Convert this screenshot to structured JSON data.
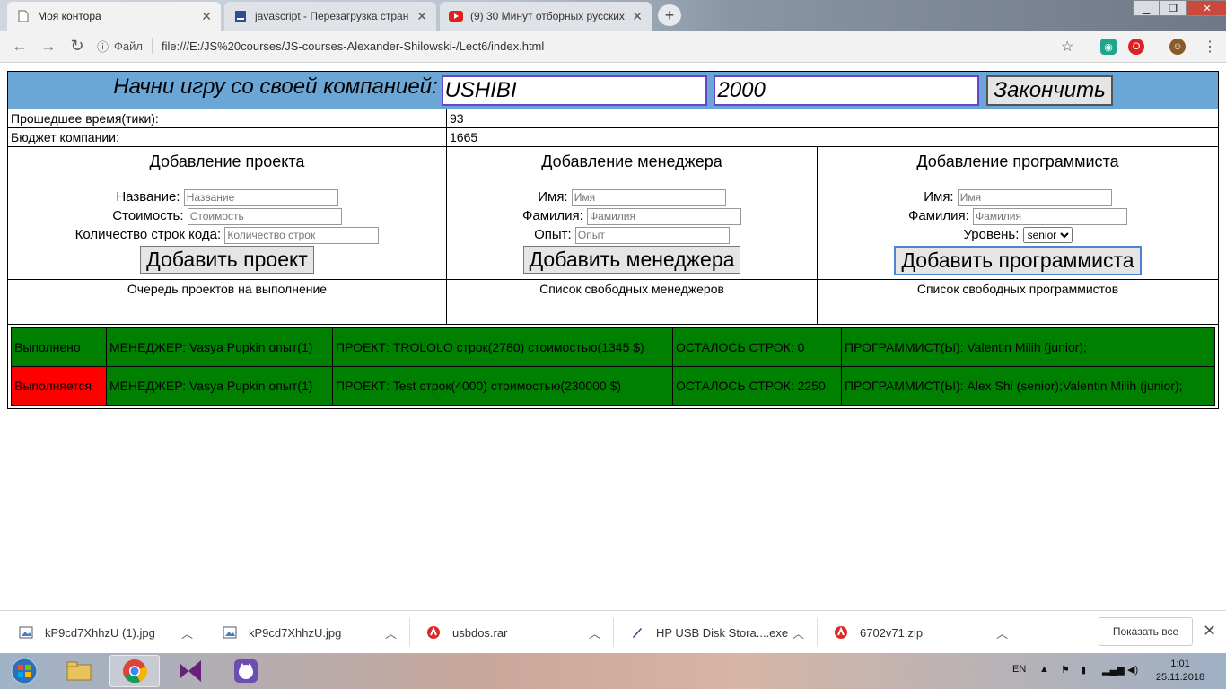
{
  "browser": {
    "tabs": [
      {
        "title": "Моя контора",
        "icon": "page-icon"
      },
      {
        "title": "javascript - Перезагрузка стран",
        "icon": "stackoverflow-icon"
      },
      {
        "title": "(9) 30 Минут отборных русских",
        "icon": "youtube-icon"
      }
    ],
    "file_label": "Файл",
    "url": "file:///E:/JS%20courses/JS-courses-Alexander-Shilowski-/Lect6/index.html"
  },
  "game": {
    "start_label": "Начни игру со своей компанией:",
    "company_name": "USHIBI",
    "start_budget": "2000",
    "finish_button": "Закончить",
    "elapsed_label": "Прошедшее время(тики):",
    "elapsed_value": "93",
    "budget_label": "Бюджет компании:",
    "budget_value": "1665"
  },
  "project_form": {
    "title": "Добавление проекта",
    "name_label": "Название:",
    "name_placeholder": "Название",
    "cost_label": "Стоимость:",
    "cost_placeholder": "Стоимость",
    "lines_label": "Количество строк кода:",
    "lines_placeholder": "Количество строк",
    "button": "Добавить проект"
  },
  "manager_form": {
    "title": "Добавление менеджера",
    "first_label": "Имя:",
    "first_placeholder": "Имя",
    "last_label": "Фамилия:",
    "last_placeholder": "Фамилия",
    "exp_label": "Опыт:",
    "exp_placeholder": "Опыт",
    "button": "Добавить менеджера"
  },
  "programmer_form": {
    "title": "Добавление программиста",
    "first_label": "Имя:",
    "first_placeholder": "Имя",
    "last_label": "Фамилия:",
    "last_placeholder": "Фамилия",
    "level_label": "Уровень:",
    "level_value": "senior",
    "button": "Добавить программиста"
  },
  "lists": {
    "queue_title": "Очередь проектов на выполнение",
    "managers_title": "Список свободных менеджеров",
    "programmers_title": "Список свободных программистов"
  },
  "work_queue": [
    {
      "status": "Выполнено",
      "status_color": "#008000",
      "manager": "МЕНЕДЖЕР: Vasya Pupkin опыт(1)",
      "project": "ПРОЕКТ: TROLOLO строк(2780) стоимостью(1345 $)",
      "remaining": "ОСТАЛОСЬ СТРОК: 0",
      "programmers": "ПРОГРАММИСТ(Ы): Valentin Milih (junior);"
    },
    {
      "status": "Выполняется",
      "status_color": "#ff0000",
      "manager": "МЕНЕДЖЕР: Vasya Pupkin опыт(1)",
      "project": "ПРОЕКТ: Test строк(4000) стоимостью(230000 $)",
      "remaining": "ОСТАЛОСЬ СТРОК: 2250",
      "programmers": "ПРОГРАММИСТ(Ы): Alex Shi (senior);Valentin Milih (junior);"
    }
  ],
  "downloads": [
    {
      "name": "kP9cd7XhhzU (1).jpg",
      "icon": "image-file-icon"
    },
    {
      "name": "kP9cd7XhhzU.jpg",
      "icon": "image-file-icon"
    },
    {
      "name": "usbdos.rar",
      "icon": "archive-icon"
    },
    {
      "name": "HP USB Disk Stora....exe",
      "icon": "exe-icon"
    },
    {
      "name": "6702v71.zip",
      "icon": "archive-icon"
    }
  ],
  "show_all": "Показать все",
  "taskbar": {
    "lang": "EN",
    "time": "1:01",
    "date": "25.11.2018"
  }
}
